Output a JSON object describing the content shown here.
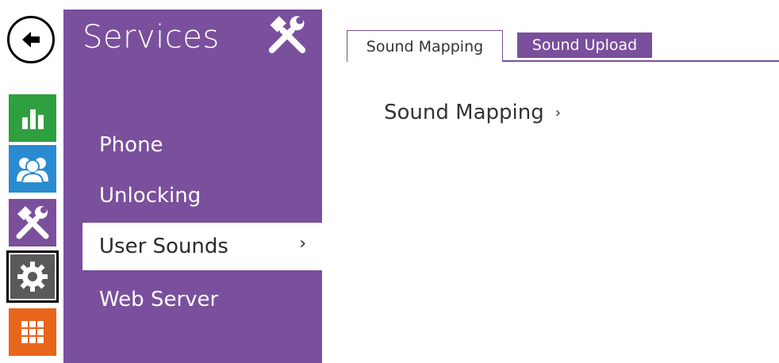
{
  "nav": {
    "back_icon": "back-arrow-icon",
    "iconbar": [
      {
        "name": "status",
        "icon": "bar-chart-icon",
        "color": "#2ea03f"
      },
      {
        "name": "directory",
        "icon": "users-icon",
        "color": "#2a8bd0"
      },
      {
        "name": "services",
        "icon": "tools-icon",
        "color": "#7a4f9c"
      },
      {
        "name": "hardware",
        "icon": "gear-icon",
        "color": "#5a5a5a"
      },
      {
        "name": "system",
        "icon": "grid-icon",
        "color": "#e8651c"
      }
    ]
  },
  "panel": {
    "title": "Services",
    "title_icon": "tools-icon",
    "accent": "#7a4f9c",
    "items": [
      {
        "label": "Phone"
      },
      {
        "label": "Unlocking"
      },
      {
        "label": "User Sounds",
        "selected": true,
        "chevron": "›"
      },
      {
        "label": "Web Server"
      }
    ]
  },
  "tabs": [
    {
      "label": "Sound Mapping",
      "active": true
    },
    {
      "label": "Sound Upload",
      "active": false
    }
  ],
  "content": {
    "section_link": "Sound Mapping",
    "section_chevron": "›"
  }
}
